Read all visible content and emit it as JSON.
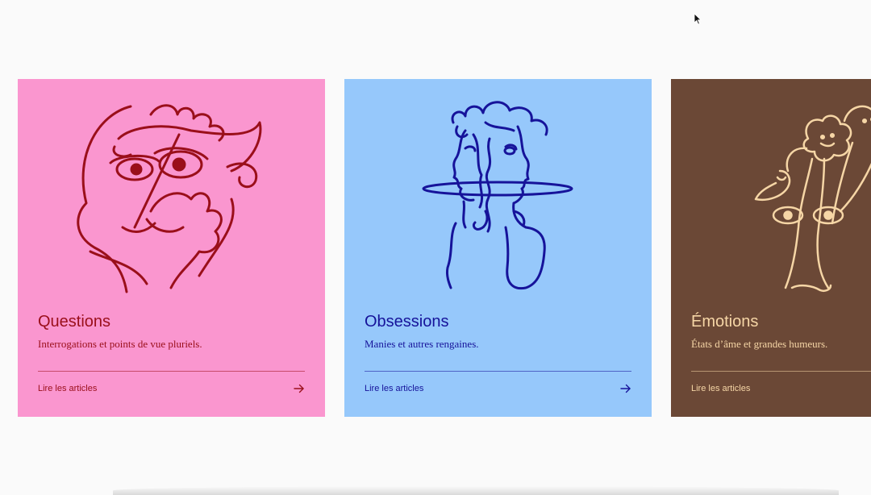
{
  "cards": [
    {
      "title": "Questions",
      "description": "Interrogations et points de vue pluriels.",
      "link_label": "Lire les articles",
      "illustration_icon": "face-thinking-illustration",
      "background_color": "#fa96cf",
      "ink_color": "#9a0f1a"
    },
    {
      "title": "Obsessions",
      "description": "Manies et autres rengaines.",
      "link_label": "Lire les articles",
      "illustration_icon": "two-faces-illustration",
      "background_color": "#96c8fb",
      "ink_color": "#16139a"
    },
    {
      "title": "Émotions",
      "description": "États d’âme et grandes humeurs.",
      "link_label": "Lire les articles",
      "illustration_icon": "flower-faces-illustration",
      "background_color": "#6b4836",
      "ink_color": "#f6d6a6"
    }
  ]
}
